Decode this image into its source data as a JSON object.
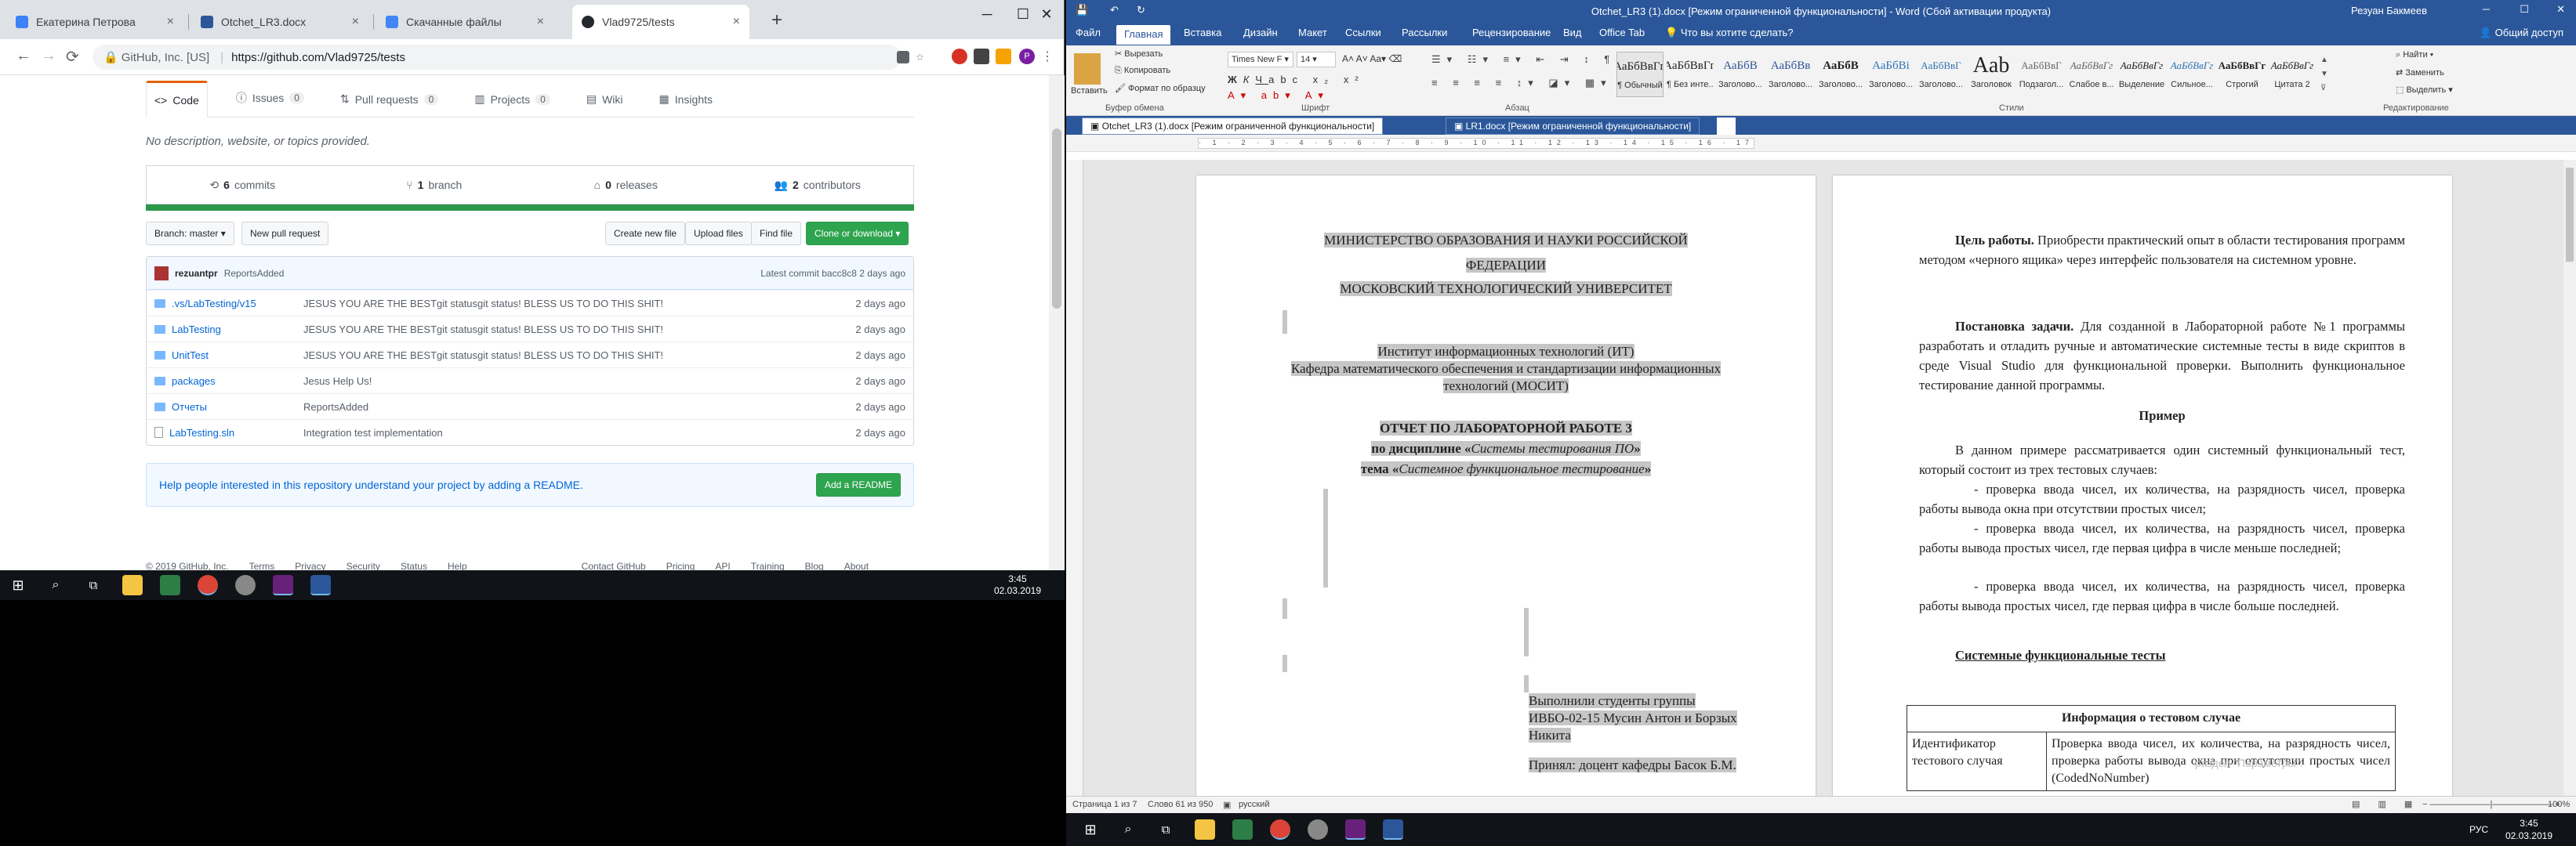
{
  "chrome": {
    "tabs": [
      {
        "title": "Екатерина Петрова",
        "fav": "#3b82f6"
      },
      {
        "title": "Otchet_LR3.docx",
        "fav": "#2b579a"
      },
      {
        "title": "Скачанные файлы",
        "fav": "#4285f4"
      },
      {
        "title": "Vlad9725/tests",
        "fav": "#24292e"
      }
    ],
    "close": "×",
    "new_tab": "+",
    "window_buttons": [
      "─",
      "☐",
      "✕"
    ],
    "nav": {
      "back": "←",
      "forward": "→",
      "reload": "⟳"
    },
    "address": {
      "secure_label": "GitHub, Inc. [US]",
      "url": "https://github.com/Vlad9725/tests"
    },
    "extensions": {
      "profile_letter": "P"
    }
  },
  "github": {
    "nav": [
      {
        "label": "Code",
        "count": ""
      },
      {
        "label": "Issues",
        "count": "0"
      },
      {
        "label": "Pull requests",
        "count": "0"
      },
      {
        "label": "Projects",
        "count": "0"
      },
      {
        "label": "Wiki",
        "count": ""
      },
      {
        "label": "Insights",
        "count": ""
      }
    ],
    "description": "No description, website, or topics provided.",
    "stats": [
      {
        "num": "6",
        "label": "commits"
      },
      {
        "num": "1",
        "label": "branch"
      },
      {
        "num": "0",
        "label": "releases"
      },
      {
        "num": "2",
        "label": "contributors"
      }
    ],
    "branch_btn": "Branch: master ▾",
    "new_pr": "New pull request",
    "create_file": "Create new file",
    "upload": "Upload files",
    "find": "Find file",
    "clone": "Clone or download ▾",
    "commit": {
      "user": "rezuantpr",
      "message": "ReportsAdded",
      "latest": "Latest commit bacc8c8 2 days ago"
    },
    "files": [
      {
        "name": ".vs/LabTesting/v15",
        "type": "folder",
        "msg": "JESUS YOU ARE THE BESTgit statusgit status! BLESS US TO DO THIS SHIT!",
        "age": "2 days ago"
      },
      {
        "name": "LabTesting",
        "type": "folder",
        "msg": "JESUS YOU ARE THE BESTgit statusgit status! BLESS US TO DO THIS SHIT!",
        "age": "2 days ago"
      },
      {
        "name": "UnitTest",
        "type": "folder",
        "msg": "JESUS YOU ARE THE BESTgit statusgit status! BLESS US TO DO THIS SHIT!",
        "age": "2 days ago"
      },
      {
        "name": "packages",
        "type": "folder",
        "msg": "Jesus Help Us!",
        "age": "2 days ago"
      },
      {
        "name": "Отчеты",
        "type": "folder",
        "msg": "ReportsAdded",
        "age": "2 days ago"
      },
      {
        "name": "LabTesting.sln",
        "type": "file",
        "msg": "Integration test implementation",
        "age": "2 days ago"
      }
    ],
    "readme_text": "Help people interested in this repository understand your project by adding a README.",
    "readme_btn": "Add a README",
    "footer": [
      "© 2019 GitHub, Inc.",
      "Terms",
      "Privacy",
      "Security",
      "Status",
      "Help",
      "Contact GitHub",
      "Pricing",
      "API",
      "Training",
      "Blog",
      "About"
    ]
  },
  "taskbar_left": {
    "time": "3:45",
    "date": "02.03.2019"
  },
  "word": {
    "title": "Otchet_LR3 (1).docx [Режим ограниченной функциональности] - Word (Сбой активации продукта)",
    "user": "Резуан Бакмеев",
    "share": "Общий доступ",
    "tabs": [
      "Файл",
      "Главная",
      "Вставка",
      "Дизайн",
      "Макет",
      "Ссылки",
      "Рассылки",
      "Рецензирование",
      "Вид",
      "Office Tab"
    ],
    "tellme": "Что вы хотите сделать?",
    "clipboard": {
      "paste": "Вставить",
      "cut": "Вырезать",
      "copy": "Копировать",
      "format": "Формат по образцу",
      "group": "Буфер обмена"
    },
    "font": {
      "name": "Times New F ▾",
      "size": "14 ▾",
      "group": "Шрифт"
    },
    "paragraph_group": "Абзац",
    "styles_group": "Стили",
    "styles": [
      {
        "pv": "АаБбВвГг,",
        "lb": "¶ Обычный"
      },
      {
        "pv": "АаБбВвГг,",
        "lb": "¶ Без инте..."
      },
      {
        "pv": "АаБбВ",
        "lb": "Заголово..."
      },
      {
        "pv": "АаБбВв",
        "lb": "Заголово..."
      },
      {
        "pv": "АаБбВ",
        "lb": "Заголово..."
      },
      {
        "pv": "АаБбВі",
        "lb": "Заголово..."
      },
      {
        "pv": "АаБбВвГ",
        "lb": "Заголово..."
      },
      {
        "pv": "Aab",
        "lb": "Заголовок"
      },
      {
        "pv": "АаБбВвГ",
        "lb": "Подзагол..."
      },
      {
        "pv": "АаБбВвГг",
        "lb": "Слабое в..."
      },
      {
        "pv": "АаБбВвГг",
        "lb": "Выделение"
      },
      {
        "pv": "АаБбВвГг",
        "lb": "Сильное..."
      },
      {
        "pv": "АаБбВвГг",
        "lb": "Строгий"
      },
      {
        "pv": "АаБбВвГг",
        "lb": "Цитата 2"
      }
    ],
    "editing": {
      "find": "Найти ▾",
      "replace": "Заменить",
      "select": "Выделить ▾",
      "group": "Редактирование"
    },
    "doc_tabs": [
      "Otchet_LR3 (1).docx [Режим ограниченной функциональности]",
      "LR1.docx [Режим ограниченной функциональности]"
    ],
    "page1": {
      "l1": "МИНИСТЕРСТВО ОБРАЗОВАНИЯ И НАУКИ РОССИЙСКОЙ",
      "l2": "ФЕДЕРАЦИИ",
      "l3": "МОСКОВСКИЙ ТЕХНОЛОГИЧЕСКИЙ УНИВЕРСИТЕТ",
      "l4": "Институт информационных технологий (ИТ)",
      "l5": "Кафедра математического обеспечения и стандартизации информационных",
      "l6": "технологий (МОСИТ)",
      "l7": "ОТЧЕТ ПО ЛАБОРАТОРНОЙ РАБОТЕ 3",
      "l8a": "по дисциплине «",
      "l8b": "Системы тестирования ПО",
      "l8c": "»",
      "l9a": "тема «",
      "l9b": "Системное функциональное тестирование",
      "l9c": "»",
      "s1": "Выполнили студенты группы",
      "s2": "ИВБО-02-15   Мусин Антон и Борзых",
      "s3": "Никита",
      "s4": "Принял: доцент кафедры Басок Б.М."
    },
    "page2": {
      "goal_label": "Цель работы.",
      "goal": " Приобрести практический опыт в области тестирования программ методом «черного ящика» через интерфейс пользователя на системном уровне.",
      "task_label": "Постановка задачи.",
      "task": " Для созданной  в Лабораторной работе №1 программы разработать и отладить ручные и автоматические системные тесты в виде скриптов в среде Visual Studio для функциональной проверки. Выполнить функциональное тестирование данной программы.",
      "example": "Пример",
      "intro": "В данном примере рассматривается один системный функциональный тест, который состоит из трех тестовых случаев:",
      "c1": "-     проверка ввода чисел, их количества, на разрядность чисел, проверка работы вывода окна при отсутствии простых чисел;",
      "c2": "-     проверка ввода чисел, их количества, на разрядность чисел, проверка работы вывода простых чисел, где первая цифра в числе меньше последней;",
      "c3": "-     проверка ввода чисел, их количества, на разрядность чисел, проверка работы вывода простых чисел, где первая цифра в числе больше последней.",
      "sys_tests": "Системные функциональные тесты",
      "tbl_head": "Информация о тестовом случае",
      "tbl_c1": "Идентификатор тестового случая",
      "tbl_c2": "Проверка ввода чисел, их количества, на разрядность чисел, проверка работы вывода окна при отсутствии простых чисел  (CodedNoNumber)"
    },
    "watermark": "раздел \"Параметры\".",
    "status": {
      "page": "Страница 1 из 7",
      "words": "Слово 61 из 950",
      "lang": "русский",
      "zoom": "100%"
    },
    "clock": {
      "time": "3:45",
      "date": "02.03.2019"
    },
    "tray_lang": "РУС"
  }
}
